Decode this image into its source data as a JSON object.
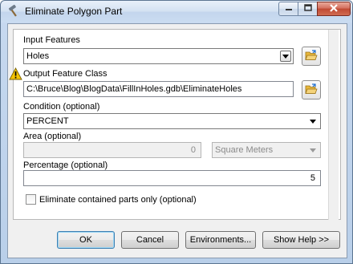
{
  "window": {
    "title": "Eliminate Polygon Part"
  },
  "form": {
    "input_features": {
      "label": "Input Features",
      "value": "Holes"
    },
    "output_feature_class": {
      "label": "Output Feature Class",
      "value": "C:\\Bruce\\Blog\\BlogData\\FillInHoles.gdb\\EliminateHoles"
    },
    "condition": {
      "label": "Condition (optional)",
      "value": "PERCENT"
    },
    "area": {
      "label": "Area (optional)",
      "value": "0",
      "unit": "Square Meters"
    },
    "percentage": {
      "label": "Percentage (optional)",
      "value": "5"
    },
    "contained_only": {
      "label": "Eliminate contained parts only (optional)",
      "checked": false
    }
  },
  "buttons": {
    "ok": "OK",
    "cancel": "Cancel",
    "environments": "Environments...",
    "show_help": "Show Help >>"
  },
  "colors": {
    "warning": "#f5c400",
    "folder": "#e8b73a",
    "default_button_border": "#3c7fb1"
  }
}
